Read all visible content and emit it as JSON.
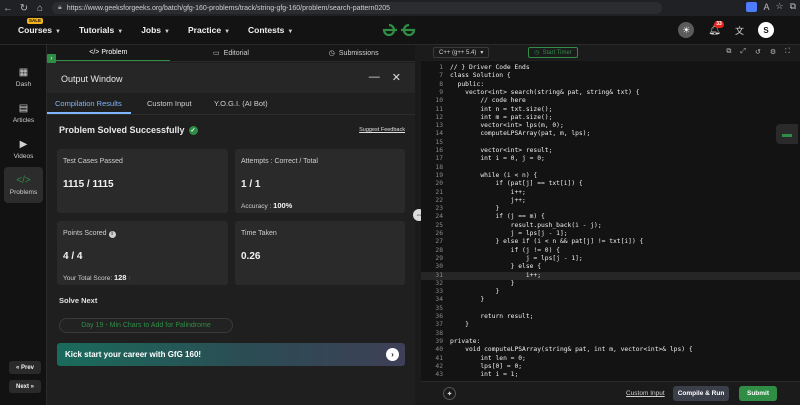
{
  "browser": {
    "url": "https://www.geeksforgeeks.org/batch/gfg-160-problems/track/string-gfg-160/problem/search-pattern0205"
  },
  "nav": {
    "sale_badge": "SALE",
    "menu": [
      {
        "label": "Courses"
      },
      {
        "label": "Tutorials"
      },
      {
        "label": "Jobs"
      },
      {
        "label": "Practice"
      },
      {
        "label": "Contests"
      }
    ],
    "notification_count": "33",
    "avatar_letter": "S"
  },
  "sidebar": {
    "items": [
      {
        "label": "Dash",
        "icon": "dashboard-icon"
      },
      {
        "label": "Articles",
        "icon": "book-icon"
      },
      {
        "label": "Videos",
        "icon": "video-icon"
      },
      {
        "label": "Problems",
        "icon": "code-icon"
      }
    ],
    "prev": "« Prev",
    "next": "Next »"
  },
  "left_tabs": {
    "problem": "</> Problem",
    "editorial": "Editorial",
    "submissions": "Submissions"
  },
  "output": {
    "title": "Output Window",
    "tabs": [
      "Compilation Results",
      "Custom Input",
      "Y.O.G.I. (AI Bot)"
    ],
    "status": "Problem Solved Successfully",
    "feedback": "Suggest Feedback",
    "cards": {
      "test_cases_label": "Test Cases Passed",
      "test_cases_value": "1115 / 1115",
      "attempts_label": "Attempts : Correct / Total",
      "attempts_value": "1 / 1",
      "accuracy_label": "Accuracy :",
      "accuracy_value": "100%",
      "points_label": "Points Scored",
      "points_value": "4 / 4",
      "total_score_label": "Your Total Score:",
      "total_score_value": "128",
      "time_label": "Time Taken",
      "time_value": "0.26"
    },
    "solve_next": "Solve Next",
    "next_problem": "Day 19 - Min Chars to Add for Palindrome",
    "banner": "Kick start your career with GfG 160!"
  },
  "editor": {
    "language": "C++ (g++ 5.4)",
    "timer": "Start Timer",
    "custom_input": "Custom Input",
    "compile_run": "Compile & Run",
    "submit": "Submit",
    "code": [
      {
        "n": "1",
        "t": "// } Driver Code Ends",
        "c": true
      },
      {
        "n": "7",
        "t": "class Solution {"
      },
      {
        "n": "8",
        "t": "  public:"
      },
      {
        "n": "9",
        "t": "    vector<int> search(string& pat, string& txt) {"
      },
      {
        "n": "10",
        "t": "        // code here",
        "c": true
      },
      {
        "n": "11",
        "t": "        int n = txt.size();"
      },
      {
        "n": "12",
        "t": "        int m = pat.size();"
      },
      {
        "n": "13",
        "t": "        vector<int> lps(m, 0);"
      },
      {
        "n": "14",
        "t": "        computeLPSArray(pat, m, lps);"
      },
      {
        "n": "15",
        "t": ""
      },
      {
        "n": "16",
        "t": "        vector<int> result;"
      },
      {
        "n": "17",
        "t": "        int i = 0, j = 0;"
      },
      {
        "n": "18",
        "t": ""
      },
      {
        "n": "19",
        "t": "        while (i < n) {"
      },
      {
        "n": "20",
        "t": "            if (pat[j] == txt[i]) {"
      },
      {
        "n": "21",
        "t": "                i++;"
      },
      {
        "n": "22",
        "t": "                j++;"
      },
      {
        "n": "23",
        "t": "            }"
      },
      {
        "n": "24",
        "t": "            if (j == m) {"
      },
      {
        "n": "25",
        "t": "                result.push_back(i - j);"
      },
      {
        "n": "26",
        "t": "                j = lps[j - 1];"
      },
      {
        "n": "27",
        "t": "            } else if (i < n && pat[j] != txt[i]) {"
      },
      {
        "n": "28",
        "t": "                if (j != 0) {"
      },
      {
        "n": "29",
        "t": "                    j = lps[j - 1];"
      },
      {
        "n": "30",
        "t": "                } else {"
      },
      {
        "n": "31",
        "t": "                    i++;",
        "h": true
      },
      {
        "n": "32",
        "t": "                }"
      },
      {
        "n": "33",
        "t": "            }"
      },
      {
        "n": "34",
        "t": "        }"
      },
      {
        "n": "35",
        "t": ""
      },
      {
        "n": "36",
        "t": "        return result;"
      },
      {
        "n": "37",
        "t": "    }"
      },
      {
        "n": "38",
        "t": ""
      },
      {
        "n": "39",
        "t": "private:"
      },
      {
        "n": "40",
        "t": "    void computeLPSArray(string& pat, int m, vector<int>& lps) {"
      },
      {
        "n": "41",
        "t": "        int len = 0;"
      },
      {
        "n": "42",
        "t": "        lps[0] = 0;"
      },
      {
        "n": "43",
        "t": "        int i = 1;"
      }
    ]
  },
  "colors": {
    "brand_green": "#2f8d46",
    "accent_blue": "#7fb6ff"
  }
}
